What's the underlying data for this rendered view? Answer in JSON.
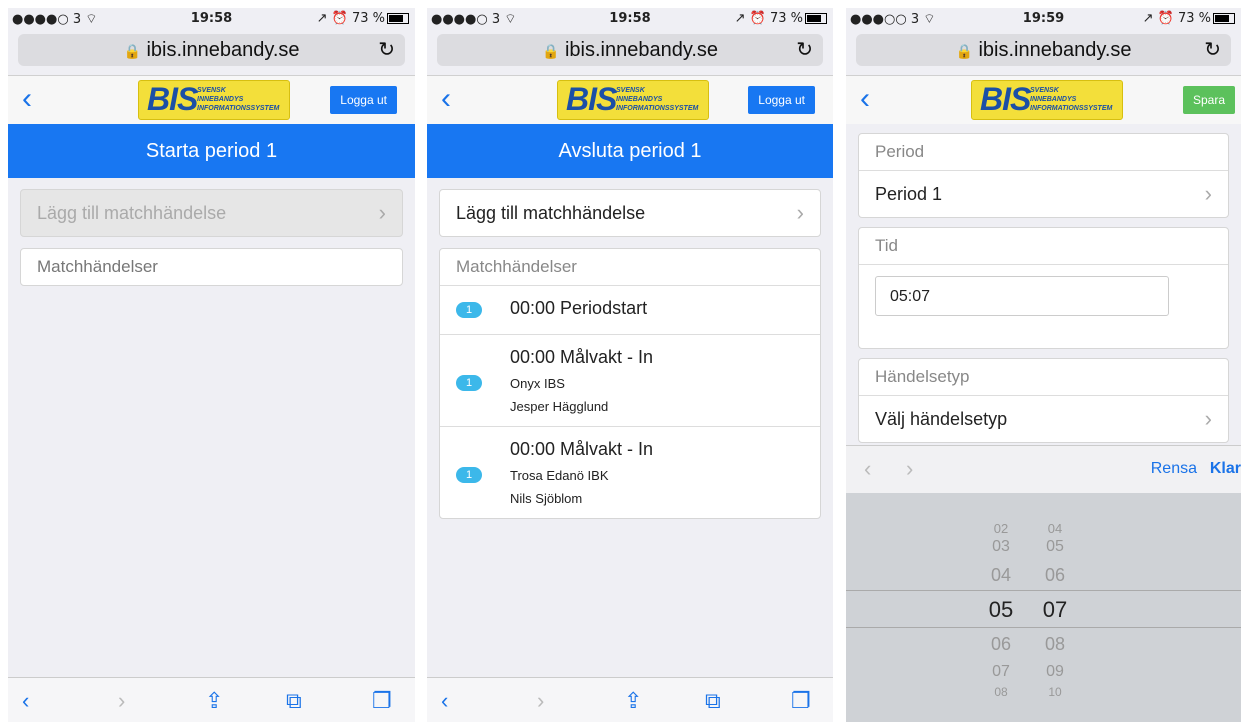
{
  "status1": {
    "left": "●●●●○ 3 ⌔",
    "time": "19:58",
    "right": "↗ ⏰ 73 %"
  },
  "status2": {
    "left": "●●●●○ 3 ⌔",
    "time": "19:58",
    "right": "↗ ⏰ 73 %"
  },
  "status3": {
    "left": "●●●○○ 3 ⌔",
    "time": "19:59",
    "right": "↗ ⏰ 73 %"
  },
  "url": "ibis.innebandy.se",
  "lock_icon": "🔒",
  "logo": {
    "big": "BIS",
    "line1": "SVENSK",
    "line2": "INNEBANDYS",
    "line3": "INFORMATIONSSYSTEM"
  },
  "screen1": {
    "logout_label": "Logga ut",
    "start_button": "Starta period 1",
    "add_event": "Lägg till matchhändelse",
    "events_header": "Matchhändelser"
  },
  "screen2": {
    "logout_label": "Logga ut",
    "end_button": "Avsluta period 1",
    "add_event": "Lägg till matchhändelse",
    "events_header": "Matchhändelser",
    "events": [
      {
        "badge": "1",
        "title": "00:00 Periodstart",
        "team": "",
        "player": ""
      },
      {
        "badge": "1",
        "title": "00:00 Målvakt - In",
        "team": "Onyx IBS",
        "player": "Jesper Hägglund"
      },
      {
        "badge": "1",
        "title": "00:00 Målvakt - In",
        "team": "Trosa Edanö IBK",
        "player": "Nils Sjöblom"
      }
    ]
  },
  "screen3": {
    "save_label": "Spara",
    "period_header": "Period",
    "period_value": "Period 1",
    "time_header": "Tid",
    "time_value": "05:07",
    "type_header": "Händelsetyp",
    "type_value": "Välj händelsetyp",
    "clear_label": "Rensa",
    "done_label": "Klar",
    "picker_minutes": [
      "02",
      "03",
      "04",
      "05",
      "06",
      "07",
      "08"
    ],
    "picker_seconds": [
      "04",
      "05",
      "06",
      "07",
      "08",
      "09",
      "10"
    ]
  }
}
